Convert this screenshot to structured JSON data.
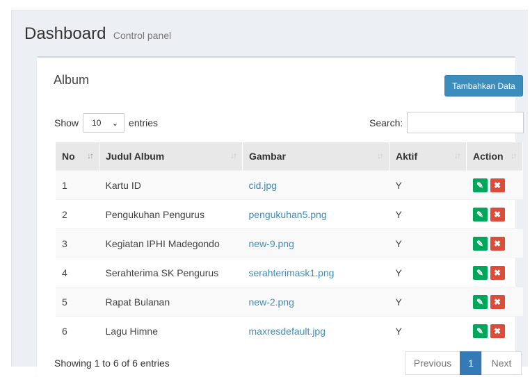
{
  "header": {
    "title": "Dashboard",
    "subtitle": "Control panel"
  },
  "box": {
    "title": "Album",
    "add_button": "Tambahkan Data"
  },
  "controls": {
    "show_label": "Show",
    "page_length": "10",
    "entries_label": "entries",
    "search_label": "Search:",
    "search_value": ""
  },
  "table": {
    "columns": [
      "No",
      "Judul Album",
      "Gambar",
      "Aktif",
      "Action"
    ],
    "rows": [
      {
        "no": "1",
        "judul": "Kartu ID",
        "gambar": "cid.jpg",
        "aktif": "Y"
      },
      {
        "no": "2",
        "judul": "Pengukuhan Pengurus",
        "gambar": "pengukuhan5.png",
        "aktif": "Y"
      },
      {
        "no": "3",
        "judul": "Kegiatan IPHI Madegondo",
        "gambar": "new-9.png",
        "aktif": "Y"
      },
      {
        "no": "4",
        "judul": "Serahterima SK Pengurus",
        "gambar": "serahterimask1.png",
        "aktif": "Y"
      },
      {
        "no": "5",
        "judul": "Rapat Bulanan",
        "gambar": "new-2.png",
        "aktif": "Y"
      },
      {
        "no": "6",
        "judul": "Lagu Himne",
        "gambar": "maxresdefault.jpg",
        "aktif": "Y"
      }
    ],
    "edit_icon": "edit-icon",
    "delete_icon": "delete-icon"
  },
  "footer": {
    "info": "Showing 1 to 6 of 6 entries",
    "previous": "Previous",
    "current_page": "1",
    "next": "Next"
  },
  "colors": {
    "primary": "#3c8dbc",
    "edit": "#00a65a",
    "delete": "#dd4b39",
    "link": "#3c8dbc"
  }
}
